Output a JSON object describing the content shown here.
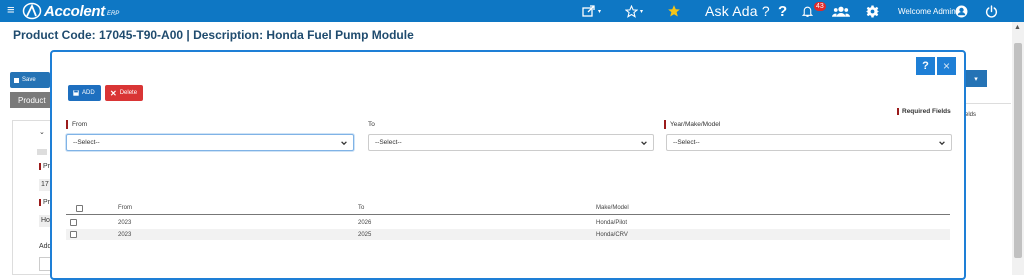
{
  "topbar": {
    "brand": "Accolent",
    "brand_suffix": "ERP",
    "ask": "Ask Ada ?",
    "help": "?",
    "notification_count": "43",
    "welcome": "Welcome Admin"
  },
  "page": {
    "title": "Product Code: 17045-T90-A00 | Description: Honda Fuel Pump Module",
    "background": {
      "save_label": "Save",
      "product_tab": "Product",
      "right_tab_text": "elds",
      "left_fragments": [
        "Pro",
        "17",
        "Pro",
        "Ho",
        "Add"
      ]
    }
  },
  "modal": {
    "help_label": "?",
    "close_label": "×",
    "add_label": "ADD",
    "delete_label": "Delete",
    "required_fields": "Required Fields",
    "fields": {
      "from_label": "From",
      "to_label": "To",
      "ymm_label": "Year/Make/Model",
      "from_value": "--Select--",
      "to_value": "--Select--",
      "ymm_value": "--Select--"
    },
    "table": {
      "columns": [
        "From",
        "To",
        "Make/Model"
      ],
      "rows": [
        {
          "from": "2023",
          "to": "2026",
          "make_model": "Honda/Pilot"
        },
        {
          "from": "2023",
          "to": "2025",
          "make_model": "Honda/CRV"
        }
      ]
    }
  },
  "colors": {
    "topbar": "#0e77c4",
    "accent": "#1e7fd6",
    "danger": "#d93535",
    "required_marker": "#9b1b1b",
    "star": "#f5c518"
  }
}
